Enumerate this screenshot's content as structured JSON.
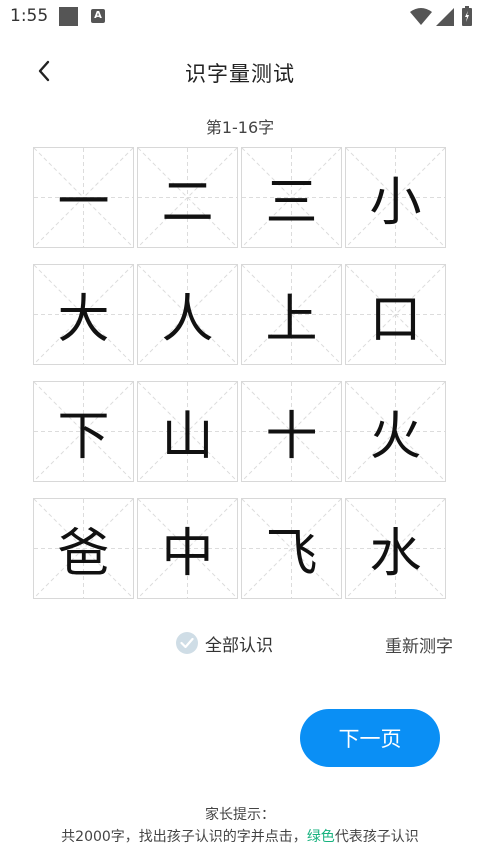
{
  "status_bar": {
    "time": "1:55",
    "a_icon_text": "A",
    "icons": [
      "notification-square-icon",
      "a-badge-icon",
      "wifi-icon",
      "signal-icon",
      "battery-icon"
    ]
  },
  "header": {
    "title": "识字量测试",
    "back_icon": "chevron-left-icon"
  },
  "range_label": "第1-16字",
  "characters": [
    "一",
    "二",
    "三",
    "小",
    "大",
    "人",
    "上",
    "口",
    "下",
    "山",
    "十",
    "火",
    "爸",
    "中",
    "飞",
    "水"
  ],
  "actions": {
    "all_known_label": "全部认识",
    "retest_label": "重新测字",
    "next_label": "下一页"
  },
  "tips": {
    "title": "家长提示：",
    "body_prefix": "共2000字，找出孩子认识的字并点击，",
    "body_highlight": "绿色",
    "body_suffix": "代表孩子认识"
  },
  "colors": {
    "accent": "#0a8ff5",
    "highlight_green": "#18b27f",
    "check_bg": "#cfdde6"
  }
}
